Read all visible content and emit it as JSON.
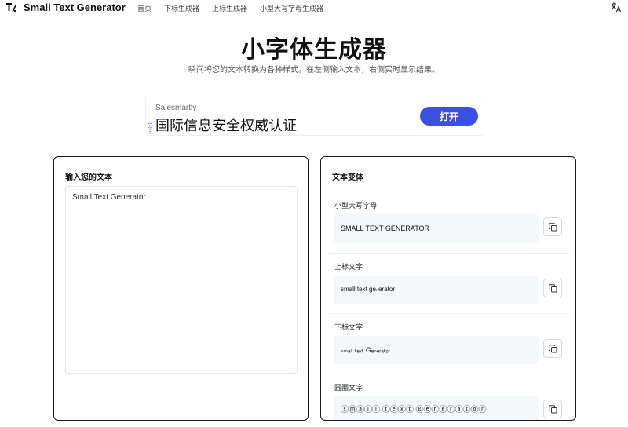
{
  "header": {
    "brand": "Small Text Generator",
    "nav": [
      "首页",
      "下标生成器",
      "上标生成器",
      "小型大写字母生成器"
    ]
  },
  "hero": {
    "title": "小字体生成器",
    "subtitle": "瞬间将您的文本转换为各种样式。在左侧输入文本，右侧实时显示结果。"
  },
  "ad": {
    "brand": "Salesmartly",
    "title": "国际信息安全权威认证",
    "button": "打开"
  },
  "input_panel": {
    "heading": "输入您的文本",
    "value": "Small Text Generator"
  },
  "output_panel": {
    "heading": "文本变体",
    "variants": [
      {
        "label": "小型大写字母",
        "output": "SMALL TEXT GENERATOR"
      },
      {
        "label": "上标文字",
        "output": "small text geₙerator"
      },
      {
        "label": "下标文字",
        "output": "ₛₘₐₗₗ ₜₑₓₜ Gₑₙₑᵣₐₜₒᵣ"
      },
      {
        "label": "圆圈文字",
        "output": "ⓢⓜⓐⓛⓛ ⓣⓔⓧⓣ ⓖⓔⓝⓔⓡⓐⓣⓞⓡ"
      }
    ]
  },
  "icons": {
    "logo": "text-logo-icon",
    "translate": "translate-icon",
    "ad_info": "ad-info-icon",
    "copy": "copy-icon"
  },
  "colors": {
    "accent": "#3b4fe0",
    "panel_border": "#1a1a1a",
    "output_bg": "#f6f7f8"
  }
}
